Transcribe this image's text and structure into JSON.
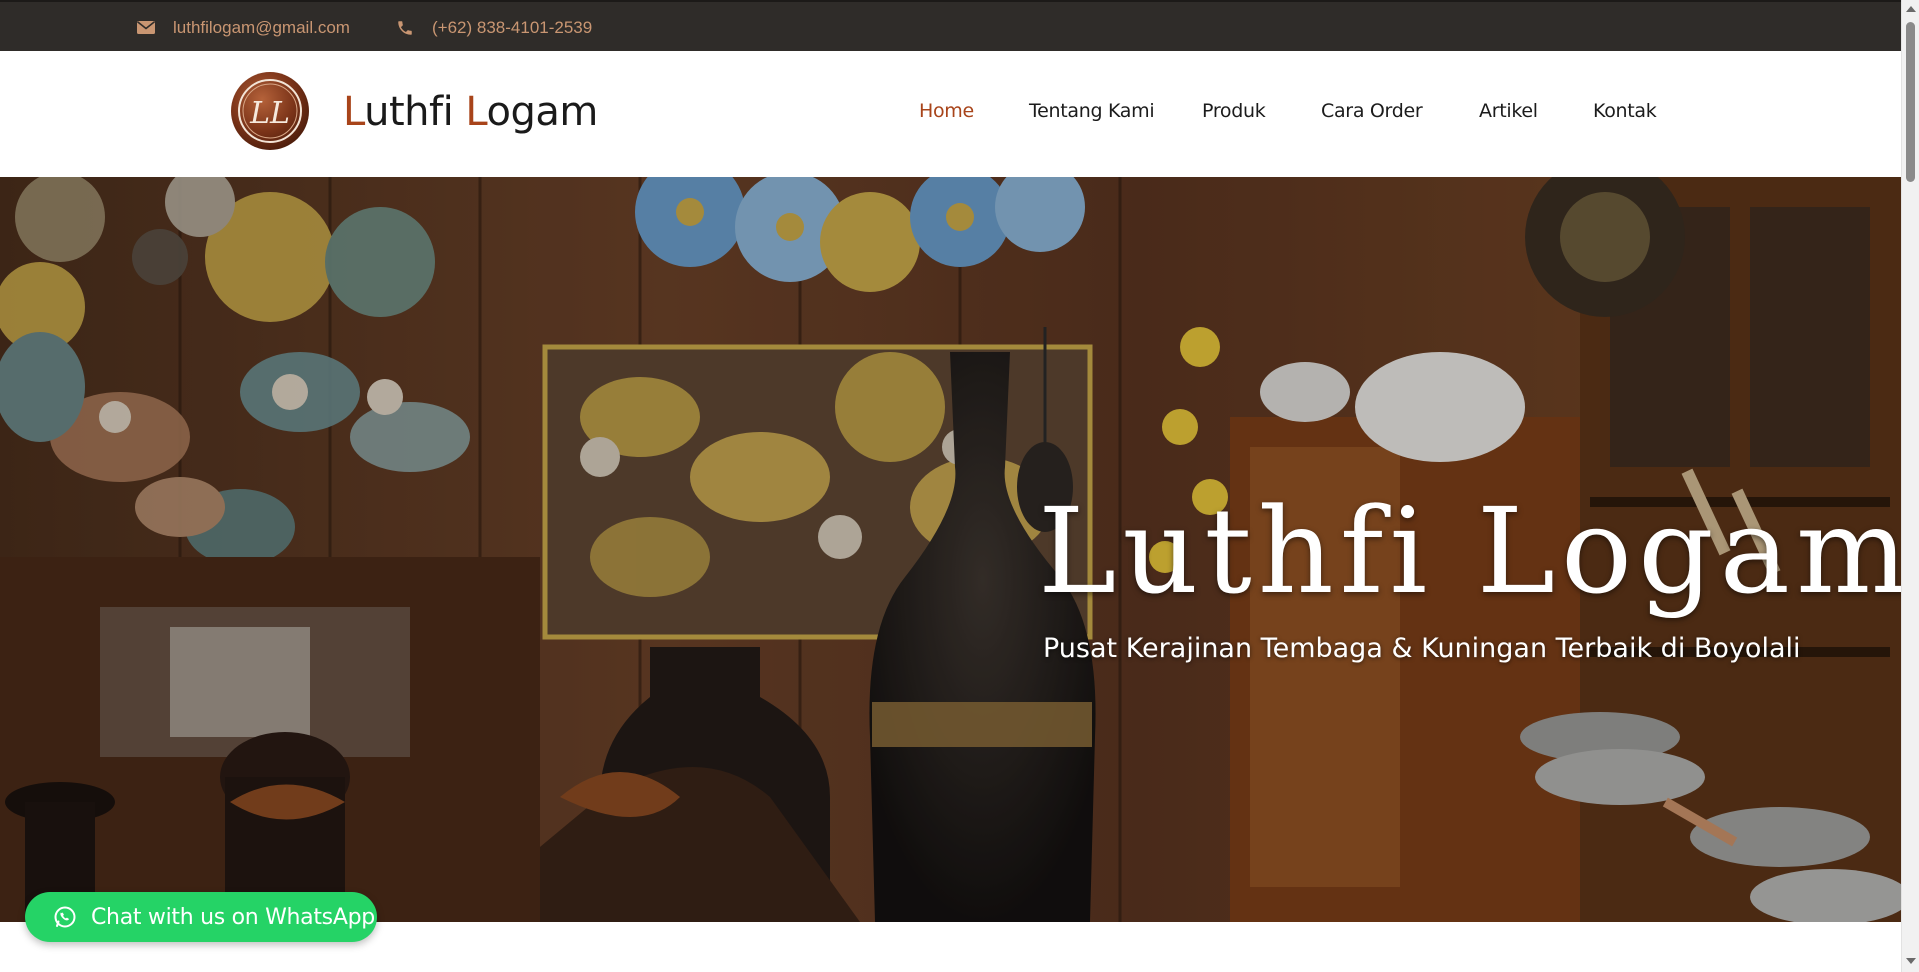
{
  "topbar": {
    "email": "luthfilogam@gmail.com",
    "phone": "(+62) 838-4101-2539"
  },
  "header": {
    "logo_text": "LL",
    "brand_first": "L",
    "brand_first_rest": "uthfi ",
    "brand_second": "L",
    "brand_second_rest": "ogam"
  },
  "nav": {
    "items": [
      {
        "label": "Home",
        "active": true
      },
      {
        "label": "Tentang Kami",
        "active": false
      },
      {
        "label": "Produk",
        "active": false
      },
      {
        "label": "Cara Order",
        "active": false
      },
      {
        "label": "Artikel",
        "active": false
      },
      {
        "label": "Kontak",
        "active": false
      }
    ]
  },
  "hero": {
    "title": "Luthfi Logam",
    "subtitle": "Pusat Kerajinan Tembaga & Kuningan Terbaik di Boyolali"
  },
  "whatsapp": {
    "label": "Chat with us on WhatsApp"
  },
  "colors": {
    "accent": "#a8441a",
    "topbar_bg": "#2f2c29",
    "topbar_text": "#c99672",
    "whatsapp": "#25d366"
  },
  "icons": [
    "envelope-icon",
    "phone-icon",
    "whatsapp-icon"
  ]
}
